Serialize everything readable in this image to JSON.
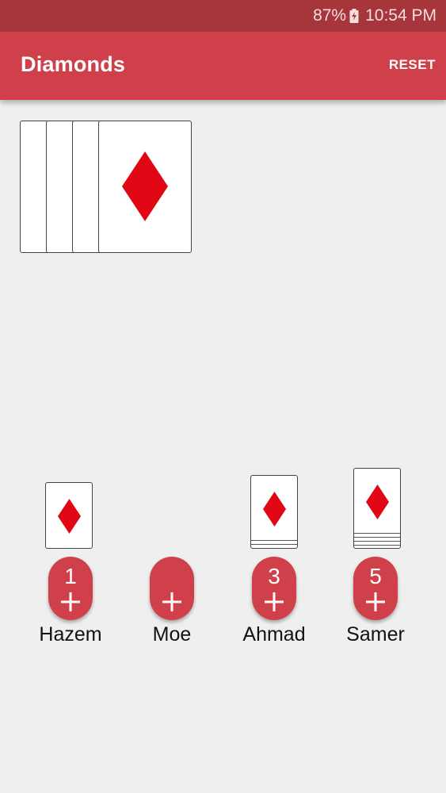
{
  "status_bar": {
    "battery": "87%",
    "time": "10:54 PM"
  },
  "app_bar": {
    "title": "Diamonds",
    "reset_label": "RESET"
  },
  "colors": {
    "accent": "#cf404b",
    "status_bar": "#a6353c",
    "diamond": "#e00613",
    "background": "#efefef"
  },
  "deck": {
    "suit_icon": "diamond-icon"
  },
  "players": [
    {
      "name": "Hazem",
      "count": "1"
    },
    {
      "name": "Moe",
      "count": ""
    },
    {
      "name": "Ahmad",
      "count": "3"
    },
    {
      "name": "Samer",
      "count": "5"
    }
  ]
}
